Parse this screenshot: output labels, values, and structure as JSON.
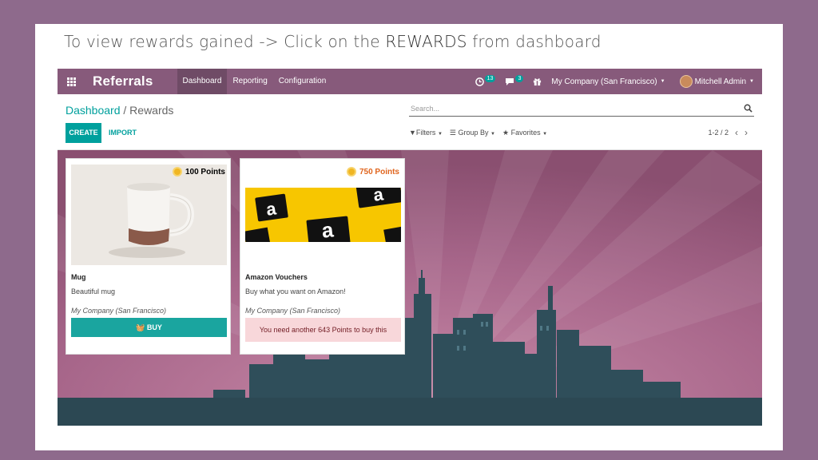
{
  "caption": {
    "prefix": "To view rewards gained -> Click on the ",
    "highlight": "REWARDS",
    "suffix": " from dashboard"
  },
  "navbar": {
    "brand": "Referrals",
    "menu": [
      "Dashboard",
      "Reporting",
      "Configuration"
    ],
    "active_menu": "Dashboard",
    "activity_count": "13",
    "message_count": "3",
    "company": "My Company (San Francisco)",
    "user": "Mitchell Admin"
  },
  "control": {
    "breadcrumb_root": "Dashboard",
    "breadcrumb_sep": " / ",
    "breadcrumb_current": "Rewards",
    "search_placeholder": "Search...",
    "create_label": "CREATE",
    "import_label": "IMPORT",
    "filters_label": "Filters",
    "groupby_label": "Group By",
    "favorites_label": "Favorites",
    "pager": "1-2 / 2"
  },
  "rewards": [
    {
      "points": "100 Points",
      "name": "Mug",
      "description": "Beautiful mug",
      "company": "My Company (San Francisco)",
      "action": "BUY",
      "image": "mug"
    },
    {
      "points": "750 Points",
      "name": "Amazon Vouchers",
      "description": "Buy what you want on Amazon!",
      "company": "My Company (San Francisco)",
      "action": "You need another 643 Points to buy this",
      "image": "amazon-gift-cards"
    }
  ],
  "colors": {
    "primary": "#875a7b",
    "accent": "#00a09d",
    "background": "#8e6a8c",
    "insufficient_bg": "#f8d7da"
  }
}
